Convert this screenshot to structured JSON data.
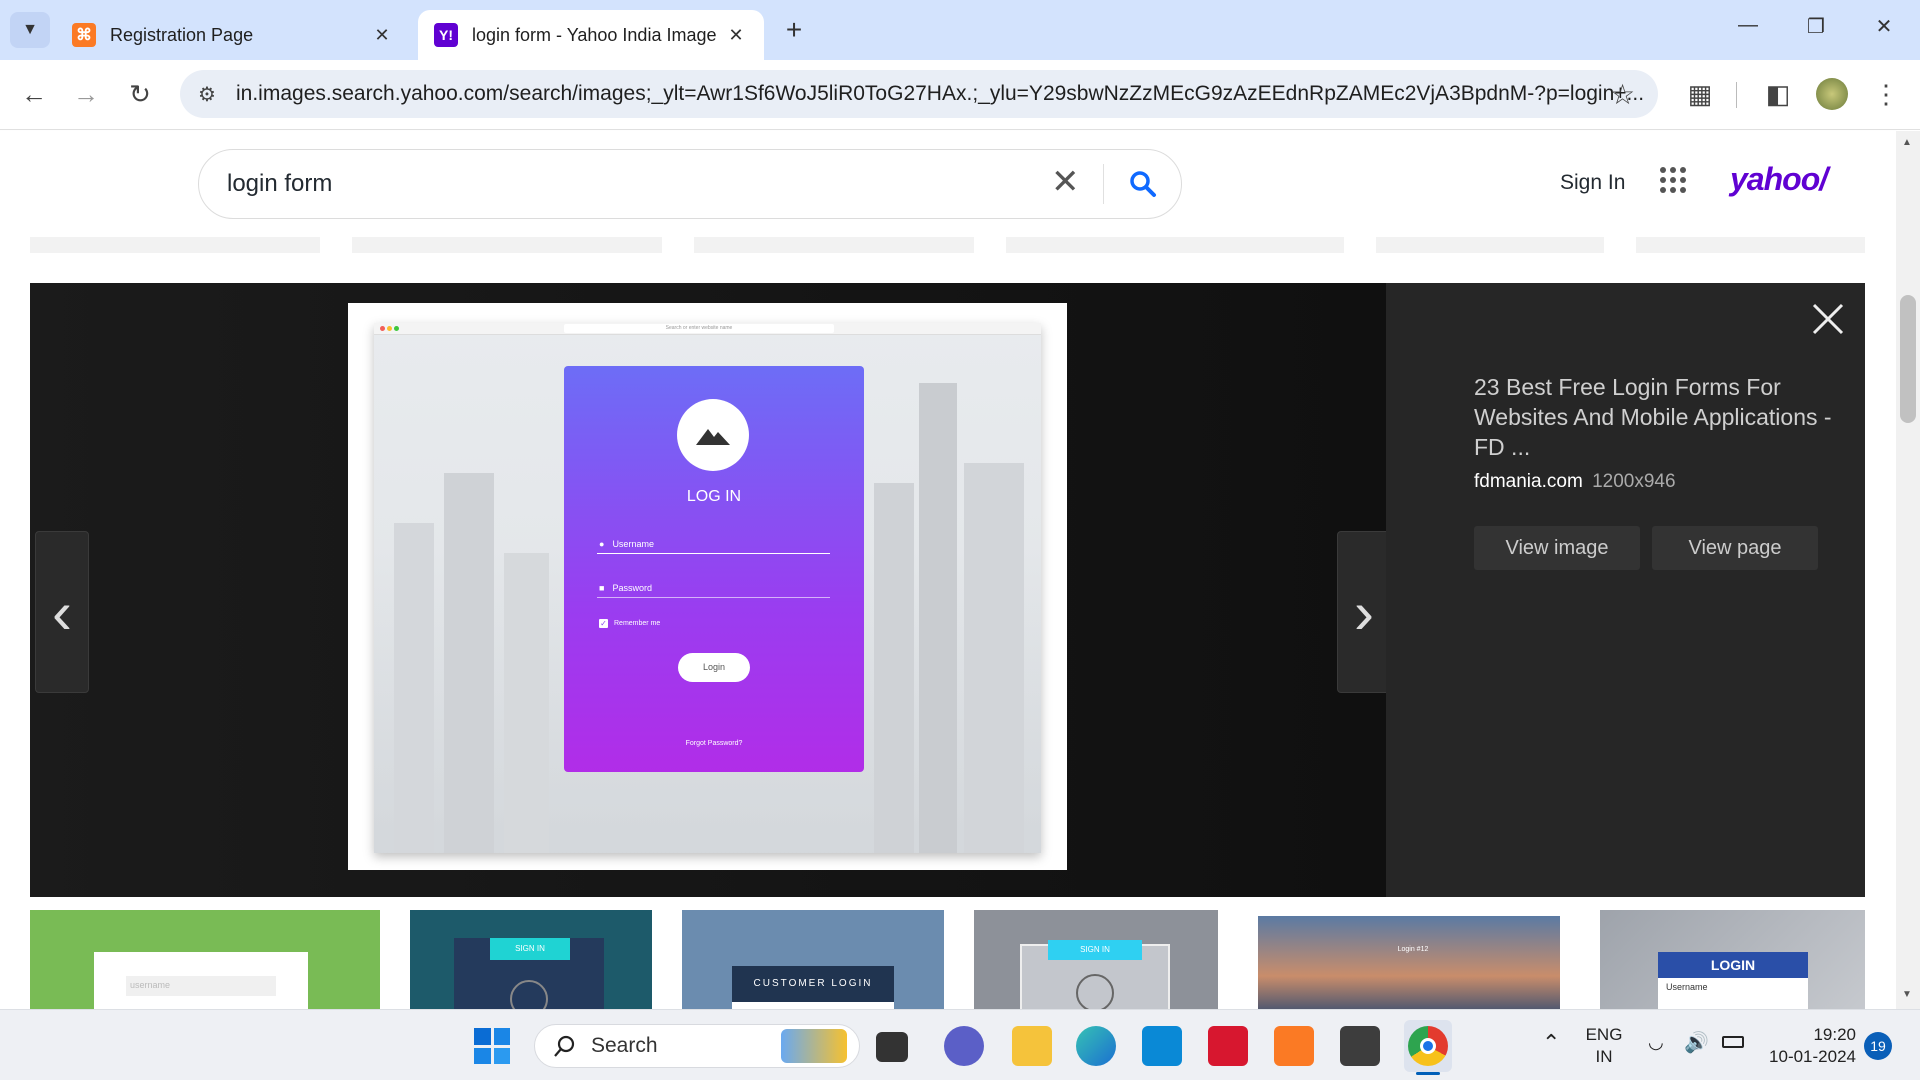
{
  "browser": {
    "tabs": [
      {
        "title": "Registration Page",
        "active": false
      },
      {
        "title": "login form - Yahoo India Image",
        "active": true
      }
    ],
    "new_tab_symbol": "+",
    "tab_close_symbol": "✕",
    "url": "in.images.search.yahoo.com/search/images;_ylt=Awr1Sf6WoJ5liR0ToG27HAx.;_ylu=Y29sbwNzZzMEcG9zAzEEdnRpZAMEc2VjA3BpdnM-?p=login+..."
  },
  "yahoo": {
    "search_query": "login form",
    "sign_in_label": "Sign In",
    "logo_text": "yahoo/"
  },
  "viewer": {
    "result_title": "23 Best Free Login Forms For Websites And Mobile Applications - FD ...",
    "source_domain": "fdmania.com",
    "dimensions": "1200x946",
    "view_image_label": "View image",
    "view_page_label": "View page",
    "preview": {
      "heading": "LOG IN",
      "username_placeholder": "Username",
      "password_placeholder": "Password",
      "remember_label": "Remember me",
      "login_button": "Login",
      "forgot_link": "Forgot Password?",
      "mock_search_placeholder": "Search or enter website name"
    }
  },
  "thumbnails": [
    {
      "text": "username"
    },
    {
      "text": "SIGN IN"
    },
    {
      "text": "CUSTOMER LOGIN"
    },
    {
      "text": "SIGN IN"
    },
    {
      "text": "Login #12"
    },
    {
      "text": "LOGIN",
      "sub": "Username"
    }
  ],
  "taskbar": {
    "search_label": "Search",
    "lang_line1": "ENG",
    "lang_line2": "IN",
    "time": "19:20",
    "date": "10-01-2024",
    "notification_count": "19"
  },
  "colors": {
    "tab_strip": "#d3e3fd",
    "yahoo_purple": "#6001d2",
    "card_top": "#6d6df6",
    "card_bottom": "#b12de8"
  }
}
